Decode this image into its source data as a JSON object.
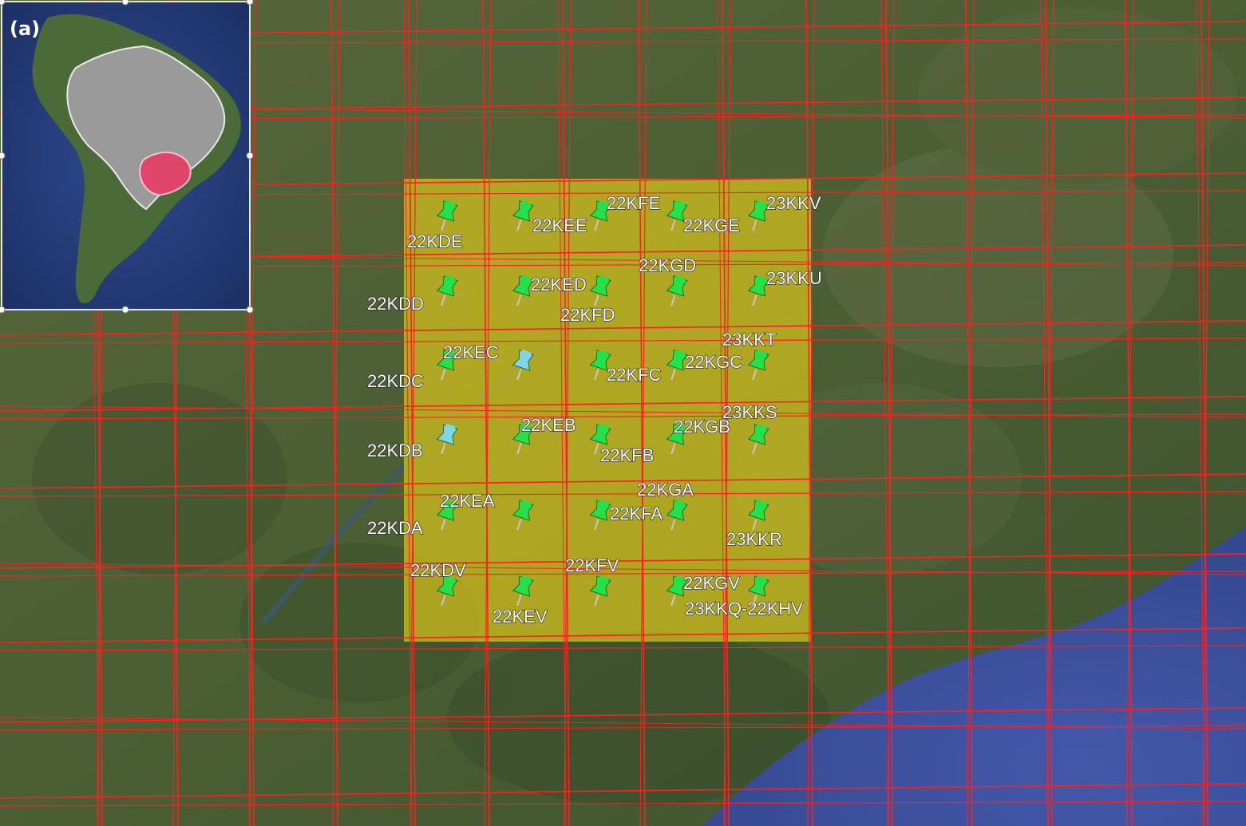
{
  "inset": {
    "letter": "(a)",
    "colors": {
      "ocean": "#2e4585",
      "continent": "#4a6a38",
      "brazil": "#9a9a9a",
      "highlight_state": "#e0466a"
    }
  },
  "colors": {
    "grid": "#ff1f1f",
    "study_area": "#d6c31b",
    "pin_green": "#26e04a",
    "pin_blue": "#7fd6e6",
    "ocean": "#3f55a8"
  },
  "markers": [
    {
      "label": "22KDE",
      "pin": "green"
    },
    {
      "label": "22KEE",
      "pin": "green"
    },
    {
      "label": "22KFE",
      "pin": "green"
    },
    {
      "label": "22KGE",
      "pin": "green"
    },
    {
      "label": "23KKV",
      "pin": "green"
    },
    {
      "label": "22KDD",
      "pin": "green"
    },
    {
      "label": "22KED",
      "pin": "green"
    },
    {
      "label": "22KFD",
      "pin": "green"
    },
    {
      "label": "22KGD",
      "pin": "green"
    },
    {
      "label": "23KKU",
      "pin": "green"
    },
    {
      "label": "22KDC",
      "pin": "green"
    },
    {
      "label": "22KEC",
      "pin": "blue"
    },
    {
      "label": "22KFC",
      "pin": "green"
    },
    {
      "label": "22KGC",
      "pin": "green"
    },
    {
      "label": "23KKT",
      "pin": "green"
    },
    {
      "label": "22KDB",
      "pin": "blue"
    },
    {
      "label": "22KEB",
      "pin": "green"
    },
    {
      "label": "22KFB",
      "pin": "green"
    },
    {
      "label": "22KGB",
      "pin": "green"
    },
    {
      "label": "23KKS",
      "pin": "green"
    },
    {
      "label": "22KDA",
      "pin": "green"
    },
    {
      "label": "22KEA",
      "pin": "green"
    },
    {
      "label": "22KFA",
      "pin": "green"
    },
    {
      "label": "22KGA",
      "pin": "green"
    },
    {
      "label": "23KKR",
      "pin": "green"
    },
    {
      "label": "22KDV",
      "pin": "green"
    },
    {
      "label": "22KEV",
      "pin": "green"
    },
    {
      "label": "22KFV",
      "pin": "green"
    },
    {
      "label": "22KGV",
      "pin": "green"
    },
    {
      "label": "23KKQ-22KHV",
      "pin": "green"
    }
  ]
}
